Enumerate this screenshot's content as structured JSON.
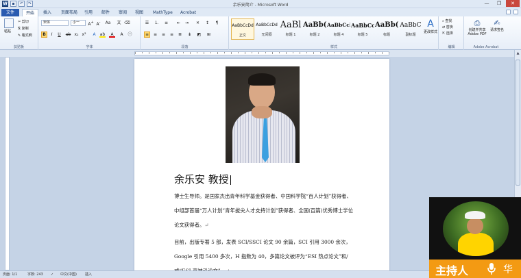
{
  "window": {
    "title": "余乐安简介 - Microsoft Word",
    "controls": {
      "minimize": "—",
      "restore": "❐",
      "close": "✕"
    }
  },
  "tabs": [
    "文件",
    "开始",
    "插入",
    "页面布局",
    "引用",
    "邮件",
    "审阅",
    "视图",
    "MathType",
    "Acrobat"
  ],
  "ribbon": {
    "clipboard": {
      "label": "剪贴板",
      "paste": "粘贴",
      "cut": "剪切",
      "copy": "复制",
      "format_painter": "格式刷"
    },
    "font": {
      "label": "字体",
      "font_name": "宋体",
      "font_size": "小一"
    },
    "paragraph": {
      "label": "段落"
    },
    "styles": {
      "label": "样式",
      "items": [
        {
          "preview": "AaBbCcDd",
          "name": "正文"
        },
        {
          "preview": "AaBbCcDd",
          "name": "无间隔"
        },
        {
          "preview": "AaBl",
          "name": "标题 1"
        },
        {
          "preview": "AaBb(",
          "name": "标题 2"
        },
        {
          "preview": "AaBbCcI",
          "name": "标题 4"
        },
        {
          "preview": "AaBbCc",
          "name": "标题 5"
        },
        {
          "preview": "AaBb(",
          "name": "标题"
        },
        {
          "preview": "AaBbC",
          "name": "副标题"
        }
      ],
      "change_styles": "更改样式"
    },
    "editing": {
      "label": "编辑",
      "find": "查找",
      "replace": "替换",
      "select": "选择"
    },
    "acrobat": {
      "label": "Adobe Acrobat",
      "create_share": "创建并共享 Adobe PDF",
      "request_sign": "请求签名"
    }
  },
  "document": {
    "heading": "余乐安 教授",
    "paragraph1": "博士生导师。是国家杰出青年科学基金获得者、中国科学院“百人计划”获得者、中组部首届“万人计划”青年拔尖人才支持计划”获得者、全国(百篇)优秀博士学位论文获得者。",
    "paragraph2": "目前，出版专著 5 部，发表 SCI/SSCI 论文 90 余篇，SCI 引用 3000 余次，Google 引用 5400 多次，H 指数为 40，多篇论文被评为“ESI 热点论文”和/或“ESI 高被引论文”。",
    "para_mark": "↵"
  },
  "statusbar": {
    "page": "页面: 1/1",
    "words": "字数: 243",
    "language": "中文(中国)",
    "mode": "插入"
  },
  "overlay": {
    "host_label": "主持人",
    "host_name_partial": "华",
    "accent": "#f39a13"
  }
}
